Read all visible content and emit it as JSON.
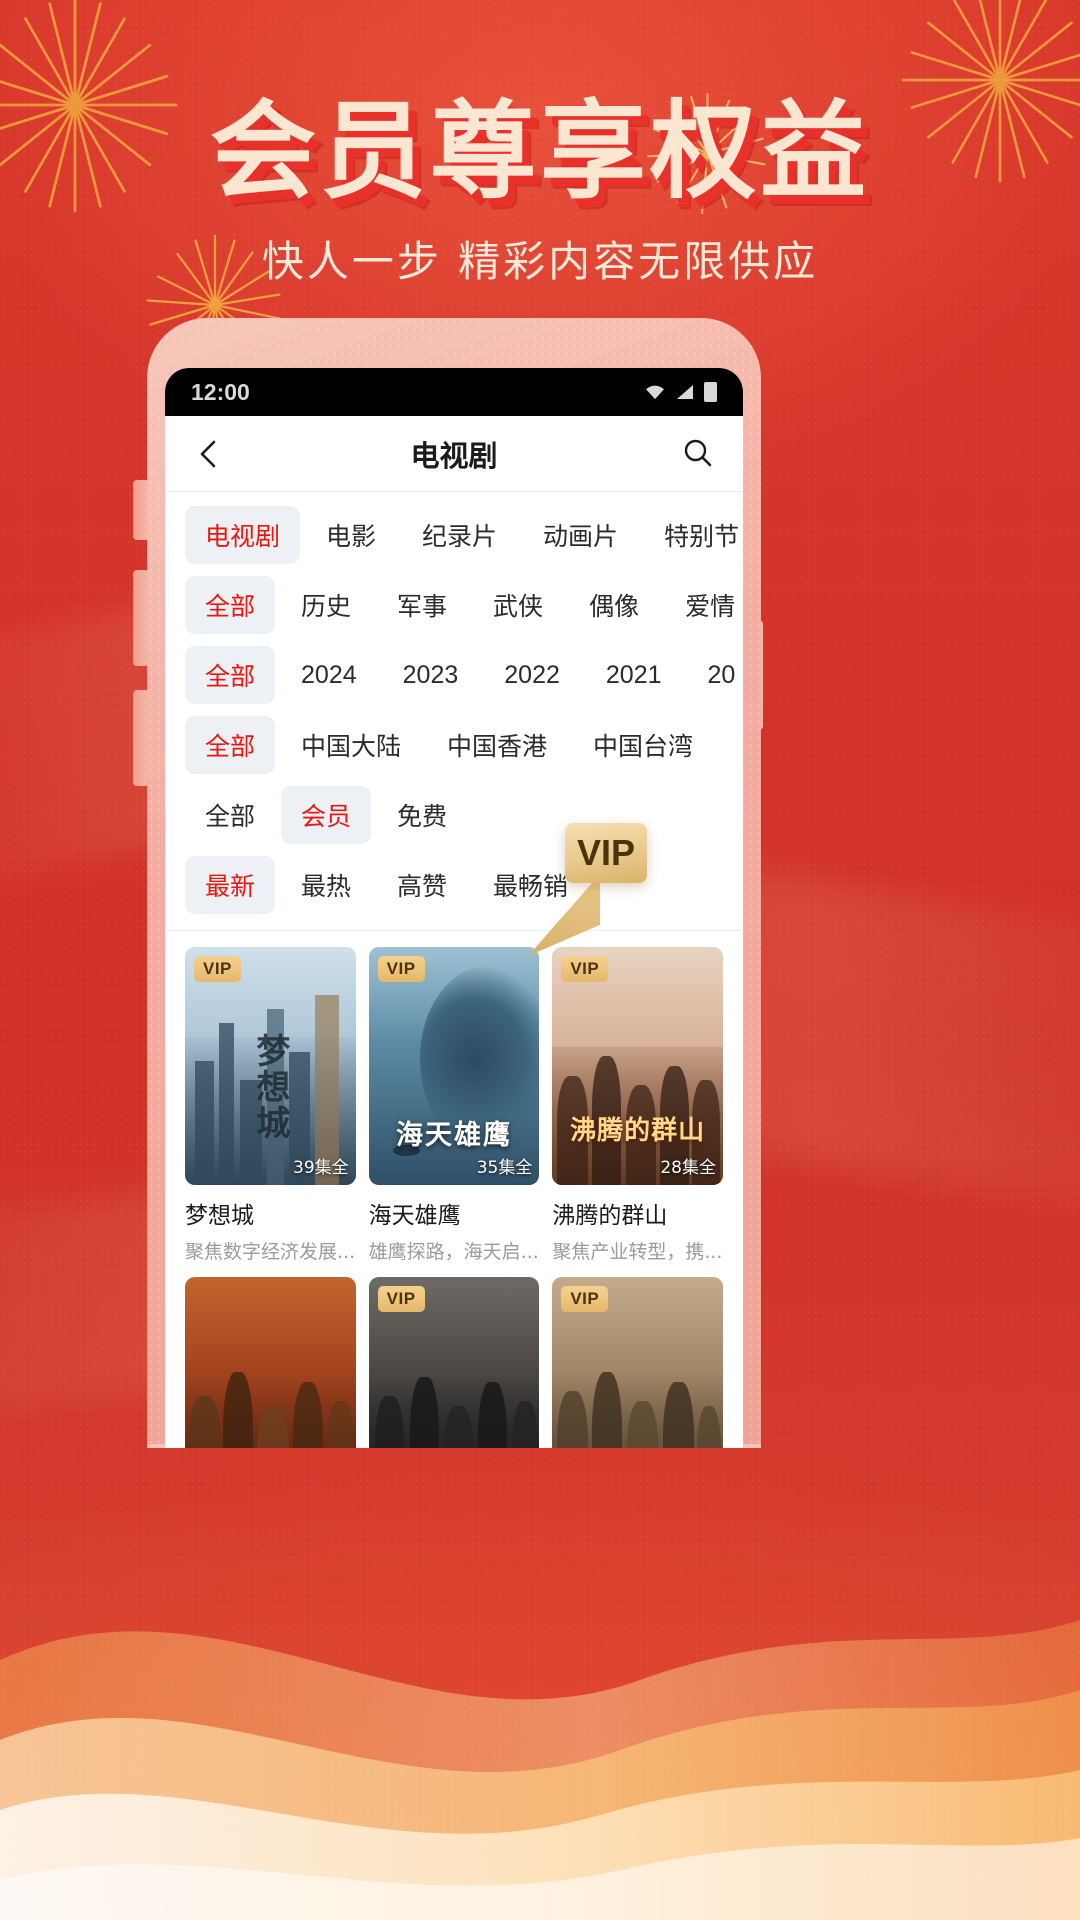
{
  "promo": {
    "title": "会员尊享权益",
    "subtitle": "快人一步  精彩内容无限供应",
    "accent_color": "#e8312a",
    "title_color": "#fbe6d2",
    "background_color": "#d6392a"
  },
  "phone": {
    "statusbar": {
      "time": "12:00",
      "icons": [
        "wifi-icon",
        "signal-icon",
        "battery-icon"
      ]
    }
  },
  "app": {
    "navbar": {
      "back_icon": "chevron-left-icon",
      "title": "电视剧",
      "search_icon": "search-icon"
    },
    "filters": [
      {
        "name": "category",
        "items": [
          "电视剧",
          "电影",
          "纪录片",
          "动画片",
          "特别节目"
        ],
        "selected": "电视剧"
      },
      {
        "name": "genre",
        "items": [
          "全部",
          "历史",
          "军事",
          "武侠",
          "偶像",
          "爱情"
        ],
        "selected": "全部"
      },
      {
        "name": "year",
        "items": [
          "全部",
          "2024",
          "2023",
          "2022",
          "2021",
          "20"
        ],
        "selected": "全部"
      },
      {
        "name": "region",
        "items": [
          "全部",
          "中国大陆",
          "中国香港",
          "中国台湾"
        ],
        "selected": "全部"
      },
      {
        "name": "membership",
        "items": [
          "全部",
          "会员",
          "免费"
        ],
        "selected": "会员"
      },
      {
        "name": "sort",
        "items": [
          "最新",
          "最热",
          "高赞",
          "最畅销"
        ],
        "selected": "最新"
      }
    ],
    "callout": {
      "label": "VIP",
      "color": "#e5c27e"
    },
    "grid": [
      {
        "title": "梦想城",
        "desc": "聚焦数字经济发展...",
        "badge": "VIP",
        "episodes": "39集全",
        "poster_text": "梦想城",
        "art": "city"
      },
      {
        "title": "海天雄鹰",
        "desc": "雄鹰探路，海天启...",
        "badge": "VIP",
        "episodes": "35集全",
        "poster_text": "海天雄鹰",
        "art": "ocean"
      },
      {
        "title": "沸腾的群山",
        "desc": "聚焦产业转型，携...",
        "badge": "VIP",
        "episodes": "28集全",
        "poster_text": "沸腾的群山",
        "art": "warm"
      },
      {
        "title": "",
        "desc": "",
        "badge": "",
        "episodes": "",
        "poster_text": "",
        "art": "heroic"
      },
      {
        "title": "",
        "desc": "",
        "badge": "VIP",
        "episodes": "",
        "poster_text": "",
        "art": "dark"
      },
      {
        "title": "",
        "desc": "",
        "badge": "VIP",
        "episodes": "",
        "poster_text": "",
        "art": "sepia"
      }
    ]
  }
}
